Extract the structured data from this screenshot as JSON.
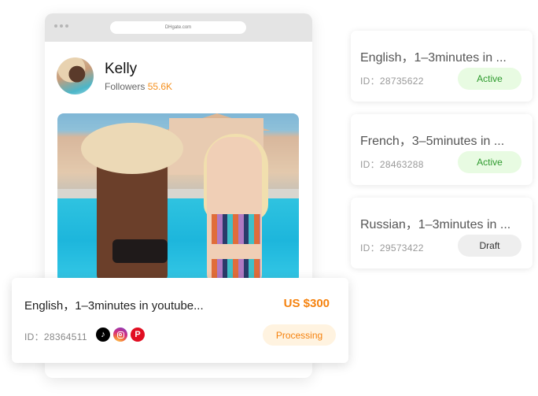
{
  "browser": {
    "url": "DHgate.com"
  },
  "profile": {
    "name": "Kelly",
    "followers_label": "Followers",
    "followers_count": "55.6K"
  },
  "order": {
    "title": "English，1–3minutes in youtube...",
    "price": "US $300",
    "id": "ID：28364511",
    "platforms": [
      "tiktok-icon",
      "instagram-icon",
      "pinterest-icon"
    ],
    "status": "Processing"
  },
  "tasks": [
    {
      "title": "English，1–3minutes in ...",
      "id": "ID：28735622",
      "status": "Active"
    },
    {
      "title": "French，3–5minutes in ...",
      "id": "ID：28463288",
      "status": "Active"
    },
    {
      "title": "Russian，1–3minutes in ...",
      "id": "ID：29573422",
      "status": "Draft"
    }
  ],
  "colors": {
    "accent_orange": "#f5820e",
    "active_green": "#2e9a2e",
    "active_bg": "#e8fbe2",
    "processing_bg": "#fff3e0",
    "draft_bg": "#eeeeee"
  }
}
